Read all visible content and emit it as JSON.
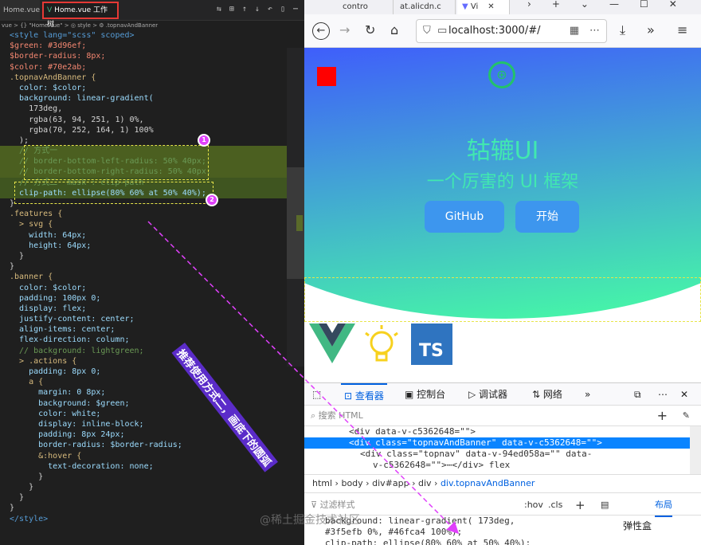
{
  "editor": {
    "tabs": [
      {
        "label": "Home.vue"
      },
      {
        "label": "Home.vue 工作树"
      }
    ],
    "breadcrumb": "vue > {} \"Home.vue\" > ◎ style > ⚙ .topnavAndBanner",
    "code_lines": [
      "<style lang=\"scss\" scoped>",
      "$green: #3d96ef;",
      "$border-radius: 8px;",
      "$color: #70e2ab;",
      ".topnavAndBanner {",
      "  color: $color;",
      "  background: linear-gradient(",
      "    173deg,",
      "    rgba(63, 94, 251, 1) 0%,",
      "    rgba(70, 252, 164, 1) 100%",
      "  );",
      "  // 方式一",
      "  // border-bottom-left-radius: 50% 40px;",
      "  // border-bottom-right-radius: 50% 40px;",
      "  // 方式二  mask : clip-path",
      "  clip-path: ellipse(80% 60% at 50% 40%);",
      "}",
      ".features {",
      "  > svg {",
      "    width: 64px;",
      "    height: 64px;",
      "  }",
      "}",
      ".banner {",
      "  color: $color;",
      "  padding: 100px 0;",
      "  display: flex;",
      "  justify-content: center;",
      "  align-items: center;",
      "  flex-direction: column;",
      "  // background: lightgreen;",
      "  > .actions {",
      "    padding: 8px 0;",
      "    a {",
      "      margin: 0 8px;",
      "      background: $green;",
      "      color: white;",
      "      display: inline-block;",
      "      padding: 8px 24px;",
      "      border-radius: $border-radius;",
      "      &:hover {",
      "        text-decoration: none;",
      "      }",
      "    }",
      "  }",
      "}",
      "</style>"
    ],
    "annotation": "推荐使用方式二，画底下的圆弧",
    "badges": [
      "1",
      "2"
    ]
  },
  "browser": {
    "tabs": [
      {
        "label": "contro"
      },
      {
        "label": "at.alicdn.c"
      },
      {
        "label": "Vi"
      }
    ],
    "url": "localhost:3000/#/",
    "page": {
      "title": "轱辘UI",
      "subtitle": "一个厉害的 UI 框架",
      "buttons": [
        "GitHub",
        "开始"
      ],
      "ts_label": "TS"
    },
    "devtools": {
      "tabs": [
        "查看器",
        "控制台",
        "调试器",
        "网络"
      ],
      "search_placeholder": "搜索 HTML",
      "dom_lines": [
        "<div data-v-c5362648=\"\">",
        "<div class=\"topnavAndBanner\" data-v-c5362648=\"\">",
        "<div class=\"topnav\" data-v-94ed058a=\"\" data-",
        "v-c5362648=\"\">⋯</div> flex"
      ],
      "crumbs": [
        "html",
        "body",
        "div#app",
        "div",
        "div.topnavAndBanner"
      ],
      "filter_placeholder": "过滤样式",
      "rule_buttons": [
        ":hov",
        ".cls"
      ],
      "layout_tab": "布局",
      "rules": [
        "background: linear-gradient( 173deg,",
        "#3f5efb 0%, #46fca4 100%);",
        "clip-path: ellipse(80% 60% at 50% 40%);"
      ],
      "layout_label": "弹性盒"
    }
  },
  "watermark": "@稀土掘金技术社区",
  "colors": {
    "hero_start": "#3f5efb",
    "hero_end": "#46fca4",
    "button": "#3d96ee",
    "accent": "#e7e54a"
  }
}
